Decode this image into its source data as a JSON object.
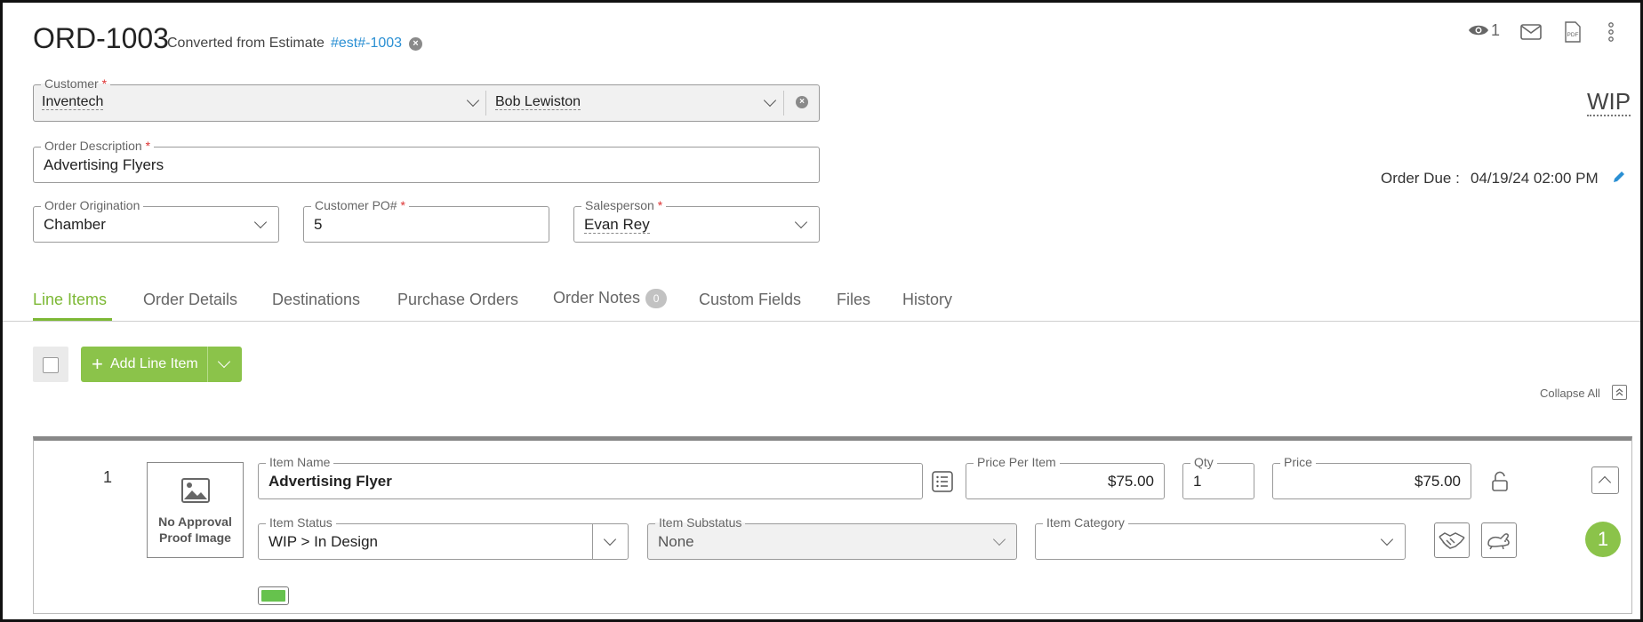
{
  "header": {
    "order_number": "ORD-1003",
    "converted_text": "Converted from Estimate",
    "estimate_link": "#est#-1003",
    "views_count": "1",
    "status": "WIP",
    "order_due_label": "Order Due :",
    "order_due_value": "04/19/24 02:00 PM"
  },
  "form": {
    "customer_label": "Customer",
    "customer_value": "Inventech",
    "contact_value": "Bob Lewiston",
    "description_label": "Order Description",
    "description_value": "Advertising Flyers",
    "origination_label": "Order Origination",
    "origination_value": "Chamber",
    "po_label": "Customer PO#",
    "po_value": "5",
    "salesperson_label": "Salesperson",
    "salesperson_value": "Evan Rey",
    "required_mark": "*"
  },
  "tabs": [
    {
      "label": "Line Items",
      "active": true
    },
    {
      "label": "Order Details"
    },
    {
      "label": "Destinations"
    },
    {
      "label": "Purchase Orders"
    },
    {
      "label": "Order Notes",
      "badge": "0"
    },
    {
      "label": "Custom Fields"
    },
    {
      "label": "Files"
    },
    {
      "label": "History"
    }
  ],
  "toolbar": {
    "add_line_item": "Add Line Item",
    "collapse_all": "Collapse All"
  },
  "line_item": {
    "number": "1",
    "image_placeholder_line1": "No Approval",
    "image_placeholder_line2": "Proof Image",
    "item_name_label": "Item Name",
    "item_name_value": "Advertising Flyer",
    "price_per_item_label": "Price Per Item",
    "price_per_item_value": "$75.00",
    "qty_label": "Qty",
    "qty_value": "1",
    "price_label": "Price",
    "price_value": "$75.00",
    "item_status_label": "Item Status",
    "item_status_value": "WIP > In Design",
    "item_substatus_label": "Item Substatus",
    "item_substatus_value": "None",
    "item_category_label": "Item Category",
    "item_category_value": "",
    "notification_count": "1"
  },
  "colors": {
    "accent_green": "#8bc34a",
    "link_blue": "#2a8fd3",
    "required_red": "#d33333"
  }
}
